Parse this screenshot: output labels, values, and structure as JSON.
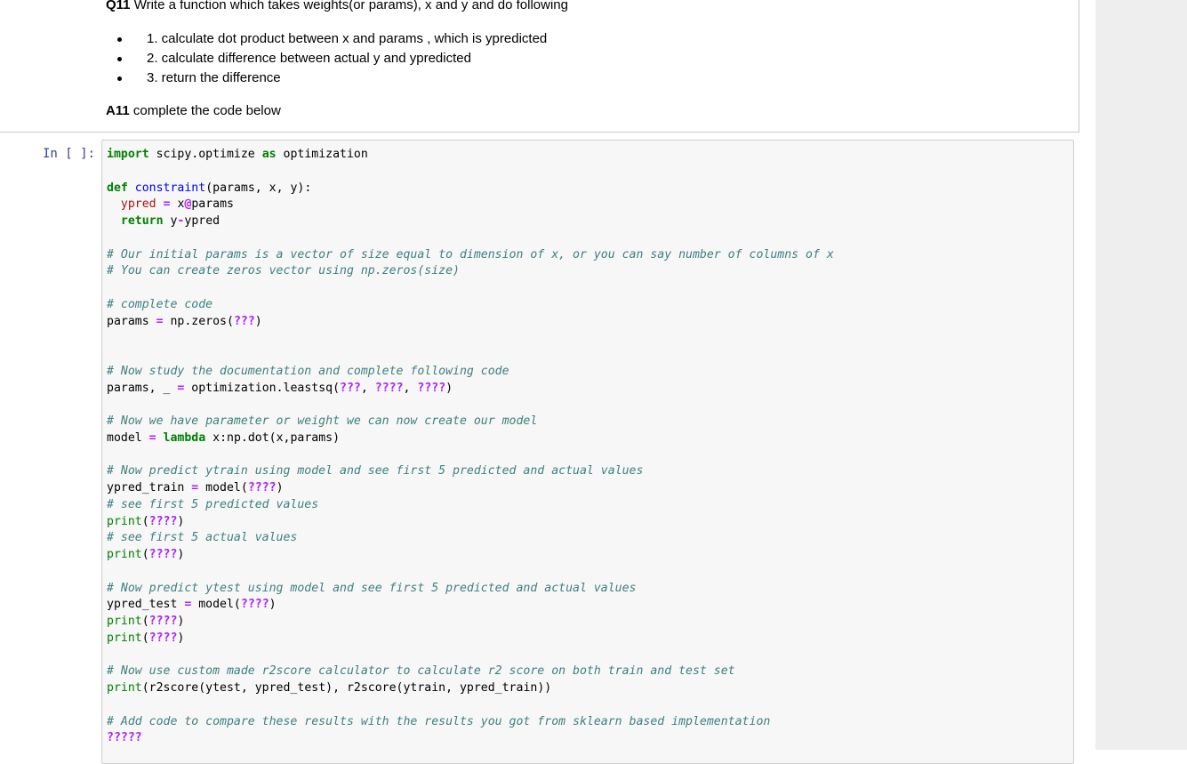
{
  "question": {
    "label": "Q11",
    "text": "Write a function which takes weights(or params), x and y and do following",
    "steps": [
      "1. calculate dot product between x and params , which is ypredicted",
      "2. calculate difference between actual y and ypredicted",
      "3. return the difference"
    ]
  },
  "answer": {
    "label": "A11",
    "text": "complete the code below"
  },
  "cell": {
    "prompt": "In [ ]:"
  },
  "code": {
    "l1_kw_import": "import",
    "l1_mod": " scipy.optimize ",
    "l1_kw_as": "as",
    "l1_alias": " optimization",
    "l3_kw_def": "def",
    "l3_fn": "constraint",
    "l3_args": "(params, x, y):",
    "l4_var": "ypred",
    "l4_eq": "=",
    "l4_rest": " x",
    "l4_at": "@",
    "l4_params": "params",
    "l5_kw_return": "return",
    "l5_rest": " y",
    "l5_minus": "-",
    "l5_ypred": "ypred",
    "c1": "# Our initial params is a vector of size equal to dimension of x, or you can say number of columns of x",
    "c2": "# You can create zeros vector using np.zeros(size)",
    "c3": "# complete code",
    "l9_a": "params ",
    "l9_eq": "=",
    "l9_b": " np.zeros(",
    "l9_q": "???",
    "l9_c": ")",
    "c4": "# Now study the documentation and complete following code",
    "l12_a": "params, _ ",
    "l12_eq": "=",
    "l12_b": " optimization.leastsq(",
    "l12_q1": "???",
    "l12_s1": ", ",
    "l12_q2": "????",
    "l12_s2": ", ",
    "l12_q3": "????",
    "l12_c": ")",
    "c5": "# Now we have parameter or weight we can now create our model",
    "l15_a": "model ",
    "l15_eq": "=",
    "l15_sp": " ",
    "l15_kw": "lambda",
    "l15_b": " x:np.dot(x,params)",
    "c6": "# Now predict ytrain using model and see first 5 predicted and actual values",
    "l18_a": "ypred_train ",
    "l18_eq": "=",
    "l18_b": " model(",
    "l18_q": "????",
    "l18_c": ")",
    "c7": "# see first 5 predicted values",
    "print_kw": "print",
    "print_open": "(",
    "print_q": "????",
    "print_close": ")",
    "c8": "# see first 5 actual values",
    "c9": "# Now predict ytest using model and see first 5 predicted and actual values",
    "l25_a": "ypred_test ",
    "l25_eq": "=",
    "l25_b": " model(",
    "l25_q": "????",
    "l25_c": ")",
    "c10": "# Now use custom made r2score calculator to calculate r2 score on both train and test set",
    "l30_rest": "(r2score(ytest, ypred_test), r2score(ytrain, ypred_train))",
    "c11": "# Add code to compare these results with the results you got from sklearn based implementation",
    "l33_q": "?????"
  }
}
